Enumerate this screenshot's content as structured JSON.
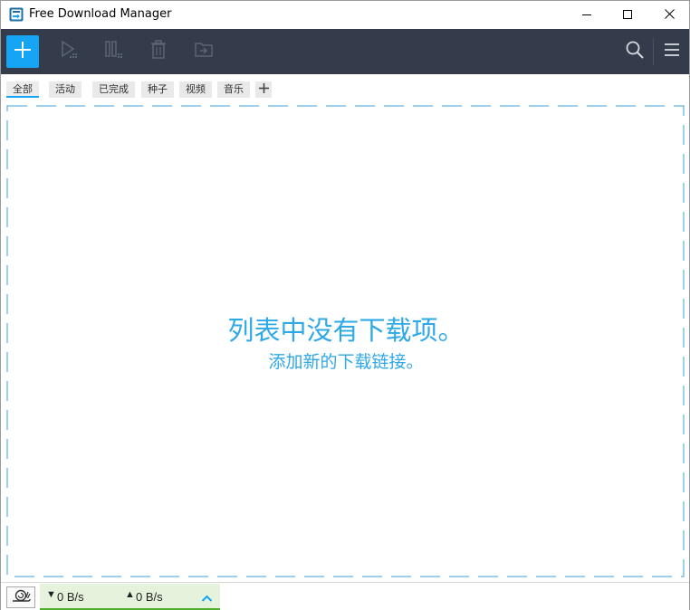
{
  "window": {
    "title": "Free Download Manager",
    "app_icon": "fdm-logo-icon",
    "controls": [
      "minimize-icon",
      "maximize-icon",
      "close-icon"
    ]
  },
  "toolbar": {
    "buttons": [
      {
        "name": "add",
        "icon": "plus-icon",
        "enabled": true
      },
      {
        "name": "start",
        "icon": "play-icon",
        "enabled": false
      },
      {
        "name": "pause",
        "icon": "pause-icon",
        "enabled": false
      },
      {
        "name": "delete",
        "icon": "trash-icon",
        "enabled": false
      },
      {
        "name": "move",
        "icon": "folder-move-icon",
        "enabled": false
      },
      {
        "name": "search",
        "icon": "search-icon",
        "enabled": true
      },
      {
        "name": "menu",
        "icon": "hamburger-menu-icon",
        "enabled": true
      }
    ]
  },
  "tabs": {
    "items": [
      "全部",
      "活动",
      "已完成",
      "种子",
      "视频",
      "音乐"
    ],
    "selected": "全部",
    "add_icon": "plus-icon"
  },
  "main": {
    "empty_title": "列表中没有下载项。",
    "empty_subtitle": "添加新的下载链接。"
  },
  "status": {
    "snail_icon": "snail-icon",
    "down_arrow": "▼",
    "down_speed": "0 B/s",
    "up_arrow": "▲",
    "up_speed": "0 B/s",
    "expand_icon": "chevron-up-icon"
  },
  "colors": {
    "accent": "#16a4f5",
    "toolbar_bg": "#343b4b",
    "empty_text": "#2ea8e6",
    "speed_panel_bg": "#e5f3dd",
    "speed_panel_bar": "#4fae2c"
  }
}
